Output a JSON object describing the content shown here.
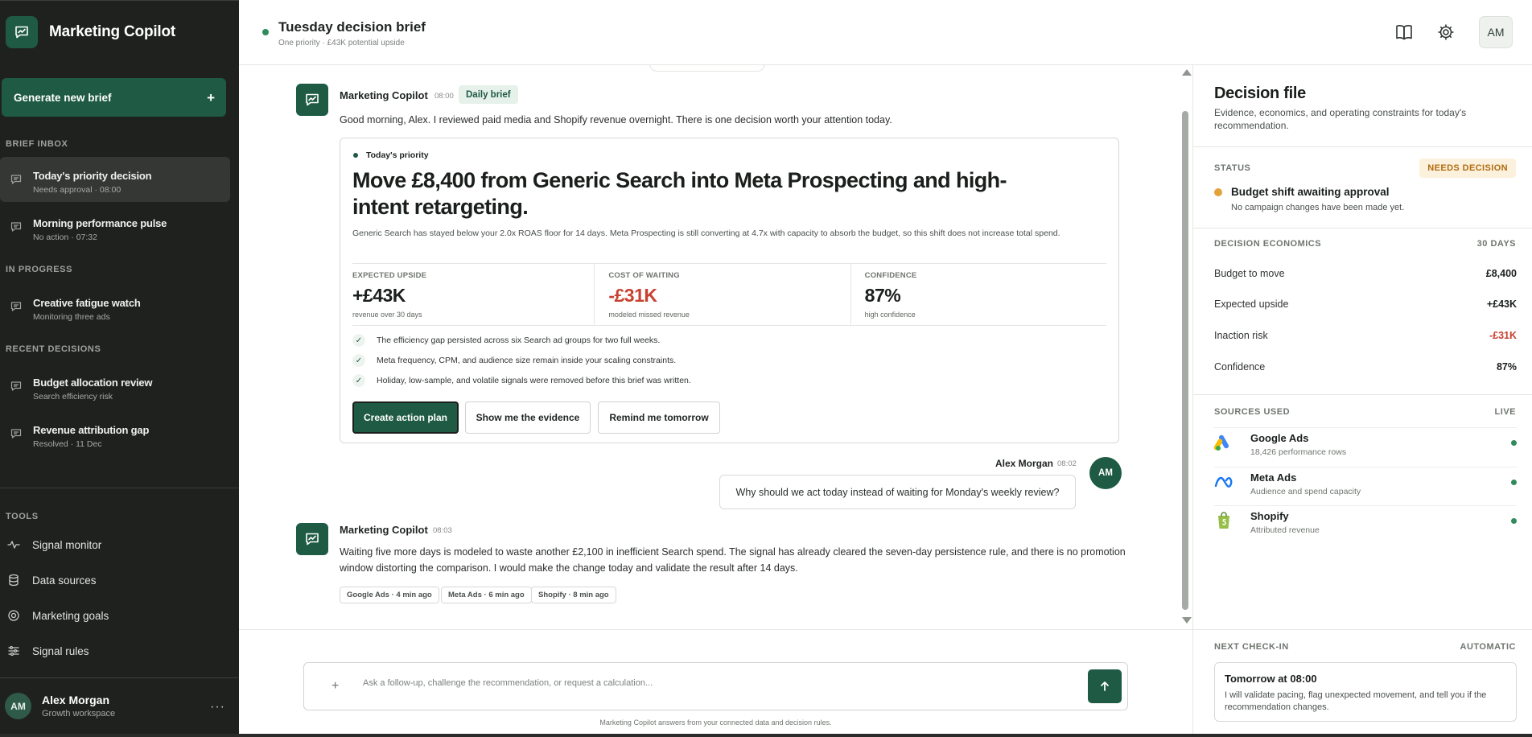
{
  "sidebar": {
    "brand": "Marketing Copilot",
    "generate_label": "Generate new brief",
    "generate_plus": "+",
    "sections": {
      "inbox": "BRIEF INBOX",
      "progress": "IN PROGRESS",
      "recent": "RECENT DECISIONS",
      "tools": "TOOLS"
    },
    "items": [
      {
        "title": "Today's priority decision",
        "sub": "Needs approval · 08:00"
      },
      {
        "title": "Morning performance pulse",
        "sub": "No action · 07:32"
      },
      {
        "title": "Creative fatigue watch",
        "sub": "Monitoring three ads"
      },
      {
        "title": "Budget allocation review",
        "sub": "Search efficiency risk"
      },
      {
        "title": "Revenue attribution gap",
        "sub": "Resolved · 11 Dec"
      }
    ],
    "tools": [
      "Signal monitor",
      "Data sources",
      "Marketing goals",
      "Signal rules"
    ],
    "user": {
      "initials": "AM",
      "name": "Alex Morgan",
      "workspace": "Growth workspace",
      "more": "···"
    }
  },
  "header": {
    "title": "Tuesday decision brief",
    "subtitle": "One priority · £43K potential upside",
    "avatar": "AM"
  },
  "chat": {
    "msg1": {
      "name": "Marketing Copilot",
      "time": "08:00",
      "badge": "Daily brief",
      "text": "Good morning, Alex. I reviewed paid media and Shopify revenue overnight. There is one decision worth your attention today."
    },
    "card": {
      "tag": "Today's priority",
      "title": "Move £8,400 from Generic Search into Meta Prospecting and high-intent retargeting.",
      "description": "Generic Search has stayed below your 2.0x ROAS floor for 14 days. Meta Prospecting is still converting at 4.7x with capacity to absorb the budget, so this shift does not increase total spend.",
      "metrics": [
        {
          "label": "EXPECTED UPSIDE",
          "value": "+£43K",
          "sub": "revenue over 30 days"
        },
        {
          "label": "COST OF WAITING",
          "value": "-£31K",
          "sub": "modeled missed revenue"
        },
        {
          "label": "CONFIDENCE",
          "value": "87%",
          "sub": "high confidence"
        }
      ],
      "checks": [
        "The efficiency gap persisted across six Search ad groups for two full weeks.",
        "Meta frequency, CPM, and audience size remain inside your scaling constraints.",
        "Holiday, low-sample, and volatile signals were removed before this brief was written."
      ],
      "check_mark": "✓",
      "buttons": {
        "primary": "Create action plan",
        "evidence": "Show me the evidence",
        "remind": "Remind me tomorrow"
      }
    },
    "user_msg": {
      "name": "Alex Morgan",
      "time": "08:02",
      "initials": "AM",
      "text": "Why should we act today instead of waiting for Monday's weekly review?"
    },
    "msg2": {
      "name": "Marketing Copilot",
      "time": "08:03",
      "text_line1": "Waiting five more days is modeled to waste another £2,100 in inefficient Search spend. The signal has already cleared the seven-day persistence rule, and there is no promotion",
      "text_line2": "window distorting the comparison. I would make the change today and validate the result after 14 days.",
      "chips": [
        "Google Ads · 4 min ago",
        "Meta Ads · 6 min ago",
        "Shopify · 8 min ago"
      ]
    }
  },
  "composer": {
    "plus": "+",
    "placeholder": "Ask a follow-up, challenge the recommendation, or request a calculation...",
    "disclaimer": "Marketing Copilot answers from your connected data and decision rules."
  },
  "panel": {
    "title": "Decision file",
    "subtitle": "Evidence, economics, and operating constraints for today's recommendation.",
    "status": {
      "label": "STATUS",
      "badge": "NEEDS DECISION",
      "title": "Budget shift awaiting approval",
      "sub": "No campaign changes have been made yet."
    },
    "economics": {
      "label": "DECISION ECONOMICS",
      "period": "30 DAYS",
      "rows": [
        {
          "k": "Budget to move",
          "v": "£8,400"
        },
        {
          "k": "Expected upside",
          "v": "+£43K"
        },
        {
          "k": "Inaction risk",
          "v": "-£31K"
        },
        {
          "k": "Confidence",
          "v": "87%"
        }
      ]
    },
    "sources": {
      "label": "SOURCES USED",
      "state": "LIVE",
      "items": [
        {
          "name": "Google Ads",
          "sub": "18,426 performance rows",
          "icon": "google-ads-icon"
        },
        {
          "name": "Meta Ads",
          "sub": "Audience and spend capacity",
          "icon": "meta-icon"
        },
        {
          "name": "Shopify",
          "sub": "Attributed revenue",
          "icon": "shopify-icon"
        }
      ]
    },
    "checkin": {
      "label": "NEXT CHECK-IN",
      "mode": "AUTOMATIC",
      "title": "Tomorrow at 08:00",
      "text": "I will validate pacing, flag unexpected movement, and tell you if the recommendation changes."
    }
  },
  "colors": {
    "brand_green": "#1e5a44",
    "sidebar_bg": "#1f211f",
    "negative": "#c8412f",
    "warning": "#e3a33a",
    "live": "#2f8a5c"
  }
}
